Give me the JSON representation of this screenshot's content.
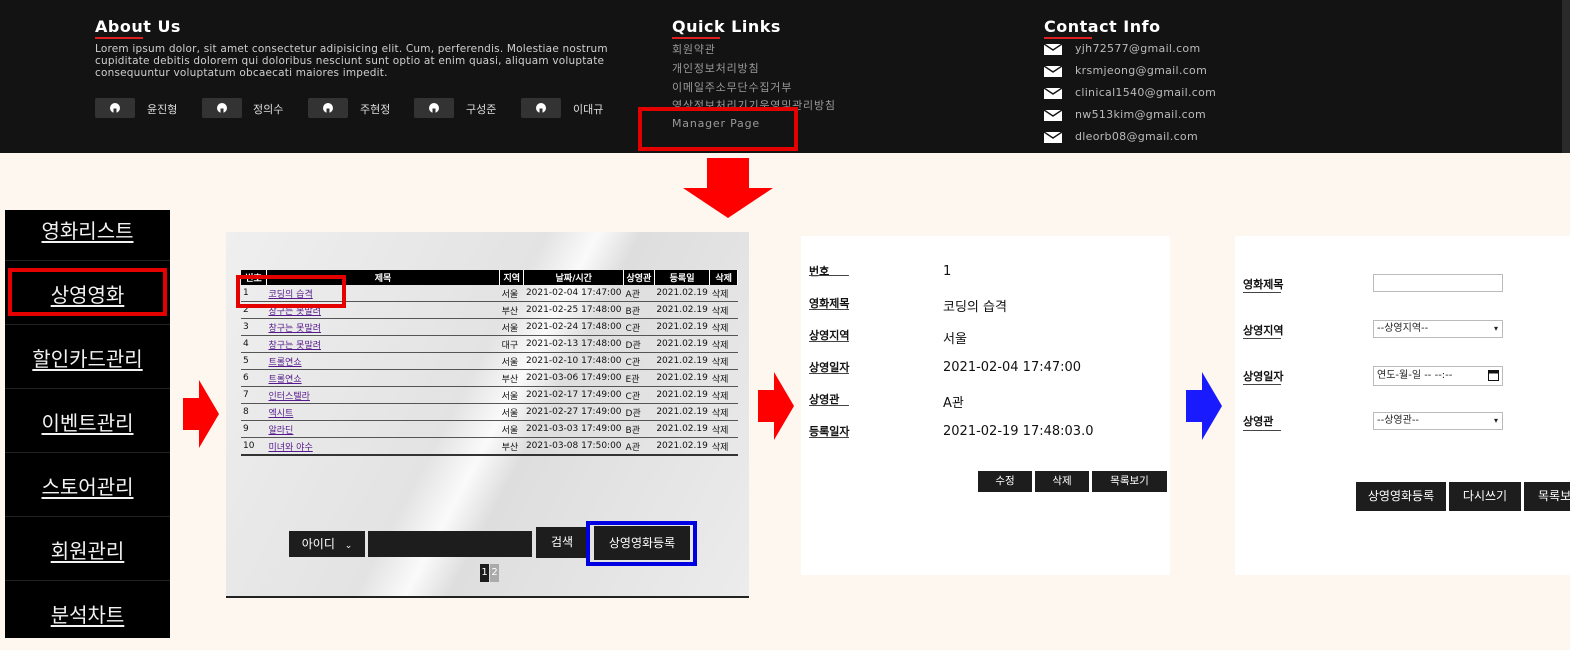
{
  "footer": {
    "about": {
      "title": "About Us",
      "text": "Lorem ipsum dolor, sit amet consectetur adipisicing elit. Cum, perferendis. Molestiae nostrum cupiditate debitis dolorem qui doloribus nesciunt sunt optio at enim quasi, aliquam voluptate consequuntur voluptatum obcaecati maiores impedit.",
      "members": [
        "윤진형",
        "정의수",
        "주현정",
        "구성준",
        "이대규"
      ]
    },
    "quick_links": {
      "title": "Quick Links",
      "items": [
        "회원약관",
        "개인정보처리방침",
        "이메일주소무단수집거부",
        "영상정보처리기기운영및관리방침",
        "Manager Page"
      ]
    },
    "contact": {
      "title": "Contact Info",
      "emails": [
        "yjh72577@gmail.com",
        "krsmjeong@gmail.com",
        "clinical1540@gmail.com",
        "nw513kim@gmail.com",
        "dleorb08@gmail.com"
      ]
    }
  },
  "sidebar": {
    "items": [
      "영화리스트",
      "상영영화",
      "할인카드관리",
      "이벤트관리",
      "스토어관리",
      "회원관리",
      "분석차트"
    ]
  },
  "table": {
    "headers": [
      "번호",
      "제목",
      "지역",
      "날짜/시간",
      "상영관",
      "등록일",
      "삭제"
    ],
    "rows": [
      [
        "1",
        "코딩의 습격",
        "서울",
        "2021-02-04 17:47:00",
        "A관",
        "2021.02.19",
        "삭제"
      ],
      [
        "2",
        "창구는 못말려",
        "부산",
        "2021-02-25 17:48:00",
        "B관",
        "2021.02.19",
        "삭제"
      ],
      [
        "3",
        "창구는 못말려",
        "서울",
        "2021-02-24 17:48:00",
        "C관",
        "2021.02.19",
        "삭제"
      ],
      [
        "4",
        "창구는 못말려",
        "대구",
        "2021-02-13 17:48:00",
        "D관",
        "2021.02.19",
        "삭제"
      ],
      [
        "5",
        "트롤연쇼",
        "서울",
        "2021-02-10 17:48:00",
        "C관",
        "2021.02.19",
        "삭제"
      ],
      [
        "6",
        "트롤연쇼",
        "부산",
        "2021-03-06 17:49:00",
        "E관",
        "2021.02.19",
        "삭제"
      ],
      [
        "7",
        "인터스텔라",
        "서울",
        "2021-02-17 17:49:00",
        "C관",
        "2021.02.19",
        "삭제"
      ],
      [
        "8",
        "엑시트",
        "서울",
        "2021-02-27 17:49:00",
        "D관",
        "2021.02.19",
        "삭제"
      ],
      [
        "9",
        "알라딘",
        "서울",
        "2021-03-03 17:49:00",
        "B관",
        "2021.02.19",
        "삭제"
      ],
      [
        "10",
        "미녀와 야수",
        "부산",
        "2021-03-08 17:50:00",
        "A관",
        "2021.02.19",
        "삭제"
      ]
    ]
  },
  "search": {
    "select_value": "아이디",
    "input_value": "",
    "search_label": "검색",
    "register_label": "상영영화등록",
    "pages": [
      "1",
      "2"
    ]
  },
  "detail": {
    "fields": [
      {
        "label": "번호",
        "value": "1"
      },
      {
        "label": "영화제목",
        "value": "코딩의 습격"
      },
      {
        "label": "상영지역",
        "value": "서울"
      },
      {
        "label": "상영일자",
        "value": "2021-02-04 17:47:00"
      },
      {
        "label": "상영관",
        "value": "A관"
      },
      {
        "label": "등록일자",
        "value": "2021-02-19 17:48:03.0"
      }
    ],
    "buttons": [
      "수정",
      "삭제",
      "목록보기"
    ]
  },
  "form": {
    "labels": [
      "영화제목",
      "상영지역",
      "상영일자",
      "상영관"
    ],
    "region_placeholder": "--상영지역--",
    "date_placeholder": "연도-월-일 -- --:--",
    "theater_placeholder": "--상영관--",
    "buttons": [
      "상영영화등록",
      "다시쓰기",
      "목록보기"
    ]
  },
  "colors": {
    "highlight_red": "#e50000",
    "highlight_blue": "#0000e0",
    "arrow_red": "#ff0000",
    "arrow_blue": "#1a1aff"
  }
}
